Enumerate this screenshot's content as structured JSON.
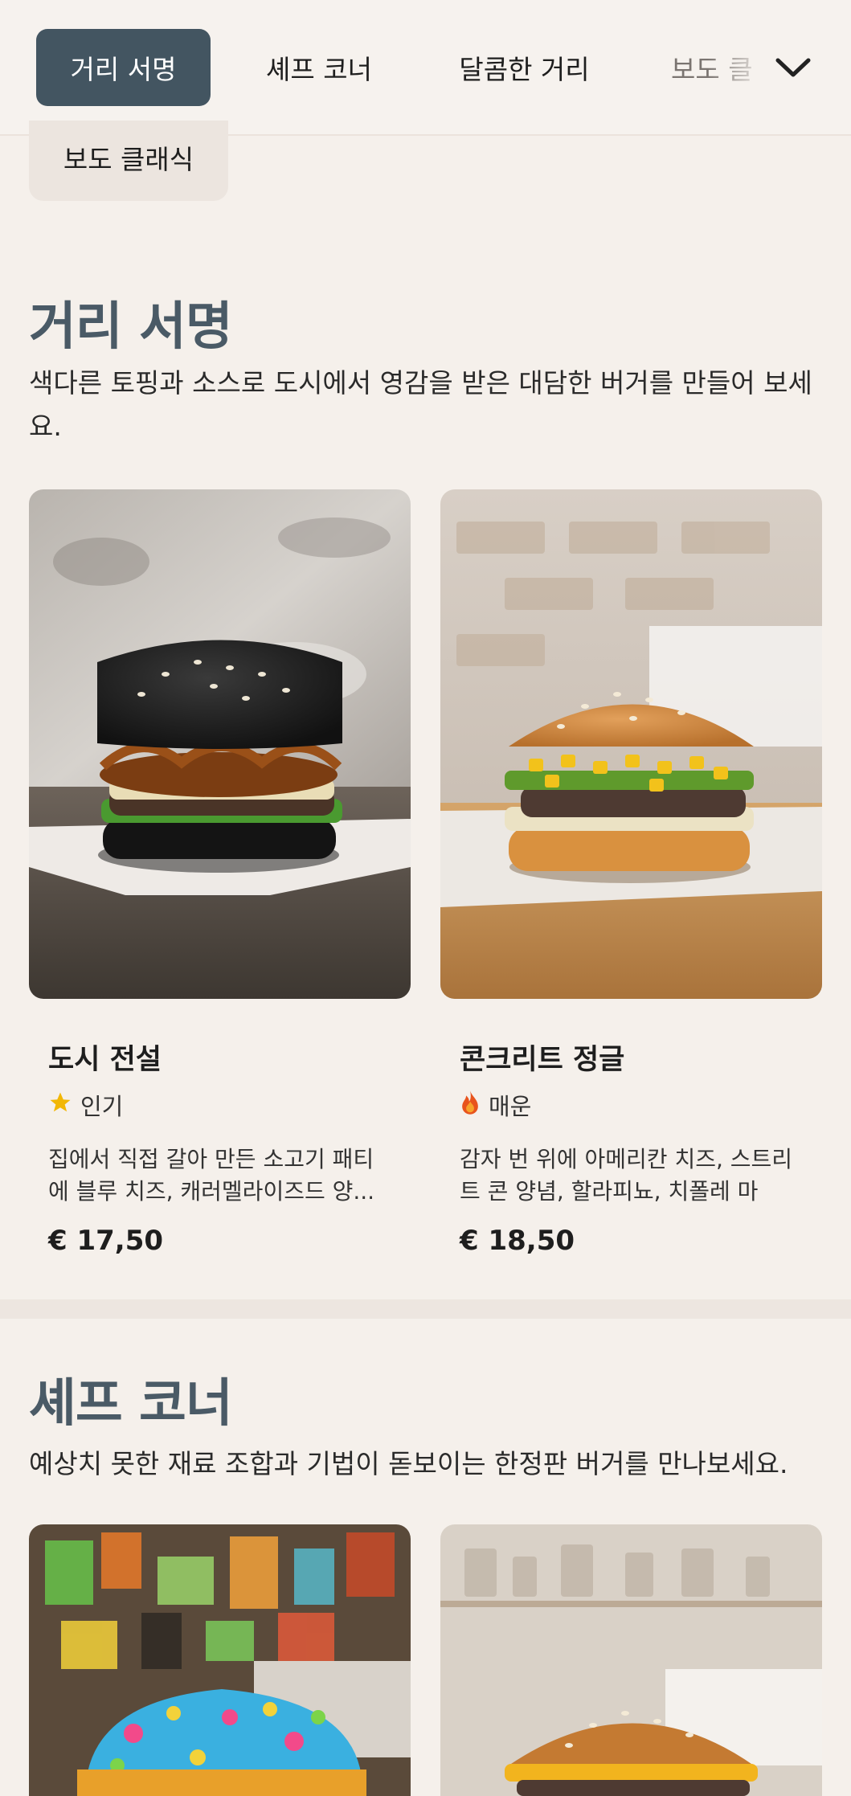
{
  "tabs": [
    {
      "label": "거리 서명",
      "active": true
    },
    {
      "label": "셰프 코너",
      "active": false
    },
    {
      "label": "달콤한 거리",
      "active": false
    },
    {
      "label": "보도 클",
      "active": false
    }
  ],
  "chip_label": "보도 클래식",
  "sections": [
    {
      "title": "거리 서명",
      "description": "색다른 토핑과 소스로 도시에서 영감을 받은 대담한 버거를 만들어 보세요.",
      "items": [
        {
          "name": "도시 전설",
          "badge": "인기",
          "badge_icon": "star-icon",
          "description": "집에서 직접 갈아 만든 소고기 패티에 블루 치즈, 캐러멜라이즈드 양...",
          "price": "€ 17,50"
        },
        {
          "name": "콘크리트 정글",
          "badge": "매운",
          "badge_icon": "flame-icon",
          "description": "감자 번 위에 아메리칸 치즈, 스트리트 콘 양념, 할라피뇨, 치폴레 마요...",
          "price": "€ 18,50"
        }
      ]
    },
    {
      "title": "셰프 코너",
      "description": "예상치 못한 재료 조합과 기법이 돋보이는 한정판 버거를 만나보세요."
    }
  ],
  "colors": {
    "accent": "#435561",
    "background": "#f5f0eb",
    "star": "#f2b705",
    "flame": "#e8541d"
  }
}
